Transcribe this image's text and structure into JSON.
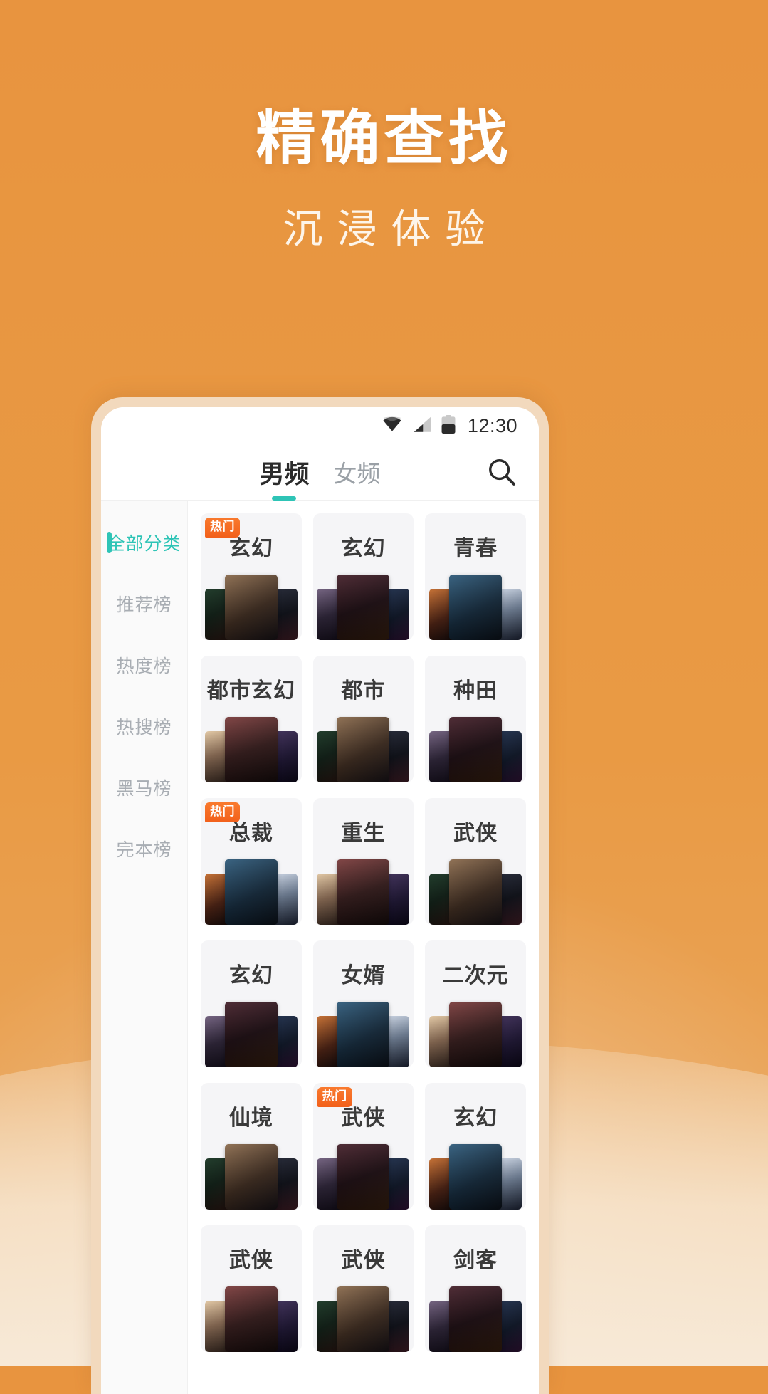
{
  "promo": {
    "headline": "精确查找",
    "subheadline": "沉浸体验",
    "background_color": "#e8943f"
  },
  "status_bar": {
    "time": "12:30",
    "icons": [
      "wifi-icon",
      "cellular-signal-icon",
      "battery-icon"
    ]
  },
  "top_bar": {
    "tabs": [
      {
        "label": "男频",
        "active": true
      },
      {
        "label": "女频",
        "active": false
      }
    ],
    "search_icon": "search-icon"
  },
  "sidebar": {
    "items": [
      {
        "label": "全部分类",
        "active": true
      },
      {
        "label": "推荐榜",
        "active": false
      },
      {
        "label": "热度榜",
        "active": false
      },
      {
        "label": "热搜榜",
        "active": false
      },
      {
        "label": "黑马榜",
        "active": false
      },
      {
        "label": "完本榜",
        "active": false
      }
    ],
    "active_color": "#2ec4b6",
    "inactive_color": "#a8adb3"
  },
  "grid": {
    "hot_badge_label": "热门",
    "hot_badge_color": "#f2601b",
    "cards": [
      {
        "title": "玄幻",
        "hot": true
      },
      {
        "title": "玄幻",
        "hot": false
      },
      {
        "title": "青春",
        "hot": false
      },
      {
        "title": "都市玄幻",
        "hot": false
      },
      {
        "title": "都市",
        "hot": false
      },
      {
        "title": "种田",
        "hot": false
      },
      {
        "title": "总裁",
        "hot": true
      },
      {
        "title": "重生",
        "hot": false
      },
      {
        "title": "武侠",
        "hot": false
      },
      {
        "title": "玄幻",
        "hot": false
      },
      {
        "title": "女婿",
        "hot": false
      },
      {
        "title": "二次元",
        "hot": false
      },
      {
        "title": "仙境",
        "hot": false
      },
      {
        "title": "武侠",
        "hot": true
      },
      {
        "title": "玄幻",
        "hot": false
      },
      {
        "title": "武侠",
        "hot": false
      },
      {
        "title": "武侠",
        "hot": false
      },
      {
        "title": "剑客",
        "hot": false
      }
    ]
  }
}
